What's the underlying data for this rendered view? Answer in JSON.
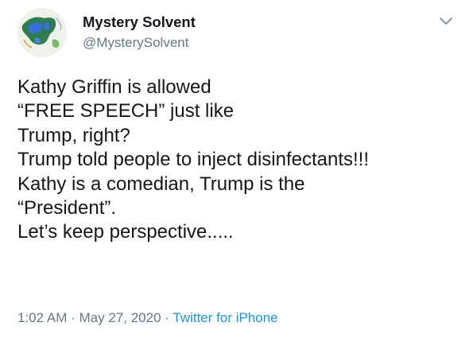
{
  "author": {
    "display_name": "Mystery Solvent",
    "handle": "@MysterySolvent",
    "avatar_icon": "lake-map-avatar"
  },
  "menu": {
    "icon": "chevron-down-icon"
  },
  "tweet": {
    "lines": [
      "Kathy Griffin is allowed",
      "“FREE SPEECH” just like",
      "Trump, right?",
      "Trump told people to inject disinfectants!!!",
      "Kathy is a comedian, Trump is the",
      "“President”.",
      "Let’s keep perspective....."
    ]
  },
  "meta": {
    "time": "1:02 AM",
    "date": "May 27, 2020",
    "source": "Twitter for iPhone",
    "separator": "·"
  },
  "colors": {
    "text": "#14171a",
    "secondary": "#657786",
    "link": "#1b95e0"
  }
}
